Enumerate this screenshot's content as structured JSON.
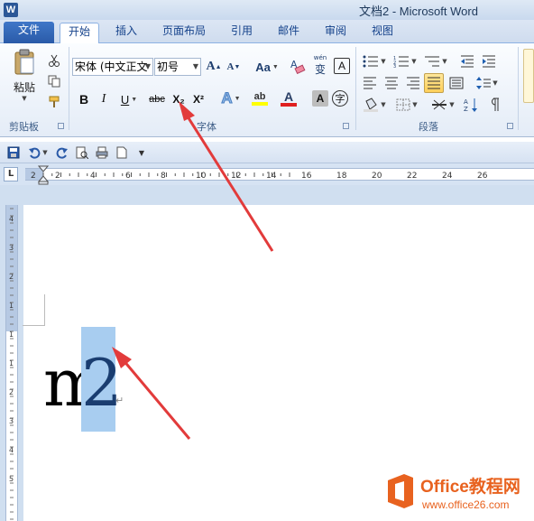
{
  "app": {
    "logo_letter": "W",
    "window_title": "文档2 - Microsoft Word"
  },
  "ribbon_tabs": [
    {
      "label": "文件",
      "state": "file"
    },
    {
      "label": "开始",
      "state": "active"
    },
    {
      "label": "插入",
      "state": ""
    },
    {
      "label": "页面布局",
      "state": ""
    },
    {
      "label": "引用",
      "state": ""
    },
    {
      "label": "邮件",
      "state": ""
    },
    {
      "label": "审阅",
      "state": ""
    },
    {
      "label": "视图",
      "state": ""
    }
  ],
  "clipboard": {
    "paste_label": "粘贴",
    "group_label": "剪贴板"
  },
  "font": {
    "font_name": "宋体 (中文正文",
    "font_size": "初号",
    "group_label": "字体",
    "grow_label": "A",
    "shrink_label": "A",
    "case_label": "Aa",
    "phonetic_label": "变",
    "border_label": "A",
    "bold_label": "B",
    "italic_label": "I",
    "underline_label": "U",
    "strike_label": "abc",
    "subscript_label": "X₂",
    "superscript_label": "X²",
    "effects_label": "A",
    "highlight_label": "ab",
    "color_label": "A",
    "shading_label": "A",
    "enclose_label": "字",
    "highlight_color": "#ffff00",
    "font_color": "#e02020"
  },
  "paragraph": {
    "group_label": "段落"
  },
  "ruler": {
    "corner_label": "L",
    "h_labels": [
      "2",
      "2",
      "4",
      "6",
      "8",
      "10",
      "12",
      "14",
      "16",
      "18",
      "20",
      "22",
      "24",
      "26"
    ],
    "v_labels": [
      "4",
      "3",
      "2",
      "1",
      "1",
      "1",
      "2",
      "3",
      "4",
      "5"
    ]
  },
  "document": {
    "base_text": "m",
    "selected_text": "2",
    "paragraph_mark": "↵"
  },
  "watermark": {
    "title": "Office教程网",
    "url": "www.office26.com"
  },
  "colors": {
    "accent": "#2b5797",
    "arrow": "#e23b3b",
    "selection": "#a8cdf0"
  }
}
